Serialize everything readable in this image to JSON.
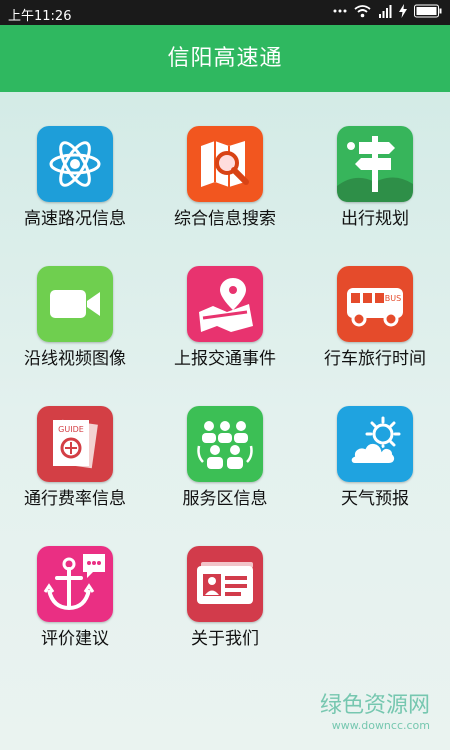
{
  "status": {
    "time": "上午11:26"
  },
  "header": {
    "title": "信阳高速通"
  },
  "menu": [
    {
      "label": "高速路况信息",
      "color": "#1e9ed9"
    },
    {
      "label": "综合信息搜索",
      "color": "#f2561f"
    },
    {
      "label": "出行规划",
      "color": "#37b55b"
    },
    {
      "label": "沿线视频图像",
      "color": "#6fcf4f"
    },
    {
      "label": "上报交通事件",
      "color": "#e8336f"
    },
    {
      "label": "行车旅行时间",
      "color": "#e54b2b"
    },
    {
      "label": "通行费率信息",
      "color": "#d33f45"
    },
    {
      "label": "服务区信息",
      "color": "#3cbf55"
    },
    {
      "label": "天气预报",
      "color": "#1fa3e0"
    },
    {
      "label": "评价建议",
      "color": "#ea2f83"
    },
    {
      "label": "关于我们",
      "color": "#d23b4b"
    }
  ],
  "watermark": {
    "main": "绿色资源网",
    "sub": "www.downcc.com"
  }
}
